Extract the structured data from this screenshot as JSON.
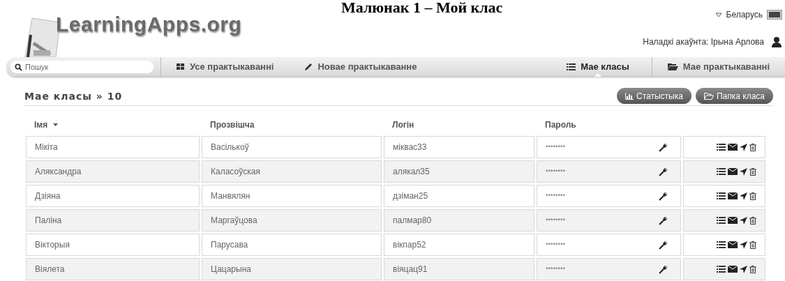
{
  "caption": "Малюнак 1 – Мой клас",
  "logo": {
    "text": "LearningApps.org"
  },
  "language": {
    "label": "Беларусь"
  },
  "account": {
    "label": "Наладкі акаўнта: Ірына Арлова"
  },
  "search": {
    "placeholder": "Пошук"
  },
  "nav": [
    {
      "label": "Усе практыкаванні",
      "kind": "grid",
      "selected": false
    },
    {
      "label": "Новае практыкаванне",
      "kind": "pencil",
      "selected": false
    },
    {
      "label": "Мае класы",
      "kind": "list",
      "selected": true
    },
    {
      "label": "Мае практыкаванні",
      "kind": "folder",
      "selected": false
    }
  ],
  "heading": {
    "title": "Мае класы",
    "separator": "»",
    "count": "10"
  },
  "buttons": [
    {
      "label": "Статыстыка",
      "kind": "chart"
    },
    {
      "label": "Папка класа",
      "kind": "folder"
    }
  ],
  "table": {
    "columns": [
      "Імя",
      "Прозвішча",
      "Логін",
      "Пароль"
    ],
    "rows": [
      {
        "first": "Мікіта",
        "last": "Васількоў",
        "login": "міквас33",
        "password": "********"
      },
      {
        "first": "Аляксандра",
        "last": "Каласоўская",
        "login": "алякал35",
        "password": "********"
      },
      {
        "first": "Дзіяна",
        "last": "Манвялян",
        "login": "дзіман25",
        "password": "********"
      },
      {
        "first": "Паліна",
        "last": "Маргаўцова",
        "login": "палмар80",
        "password": "********"
      },
      {
        "first": "Вікторыя",
        "last": "Парусава",
        "login": "вікпар52",
        "password": "********"
      },
      {
        "first": "Віялета",
        "last": "Цацарына",
        "login": "віяцац91",
        "password": "********"
      }
    ]
  }
}
